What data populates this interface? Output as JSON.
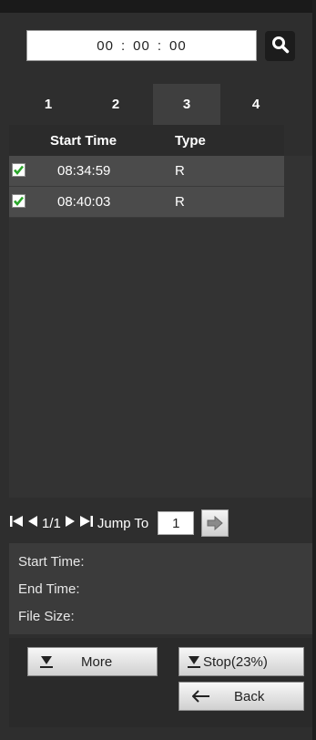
{
  "search": {
    "hours": "00",
    "minutes": "00",
    "seconds": "00",
    "sep": ":",
    "icon": "search-icon"
  },
  "tabs": [
    {
      "label": "1",
      "active": false
    },
    {
      "label": "2",
      "active": false
    },
    {
      "label": "3",
      "active": true
    },
    {
      "label": "4",
      "active": false
    }
  ],
  "list": {
    "columns": {
      "start_time": "Start Time",
      "type": "Type"
    },
    "rows": [
      {
        "checked": true,
        "start_time": "08:34:59",
        "type": "R"
      },
      {
        "checked": true,
        "start_time": "08:40:03",
        "type": "R"
      }
    ]
  },
  "pager": {
    "page": "1/1",
    "jump_label": "Jump To",
    "jump_value": "1"
  },
  "info": {
    "start_time_label": "Start Time:",
    "end_time_label": "End Time:",
    "file_size_label": "File Size:"
  },
  "actions": {
    "more_label": "More",
    "stop_label": "Stop(23%)",
    "back_label": "Back"
  },
  "colors": {
    "check": "#2aa52a",
    "background": "#2e2e2e",
    "row": "#4b4b4b"
  }
}
